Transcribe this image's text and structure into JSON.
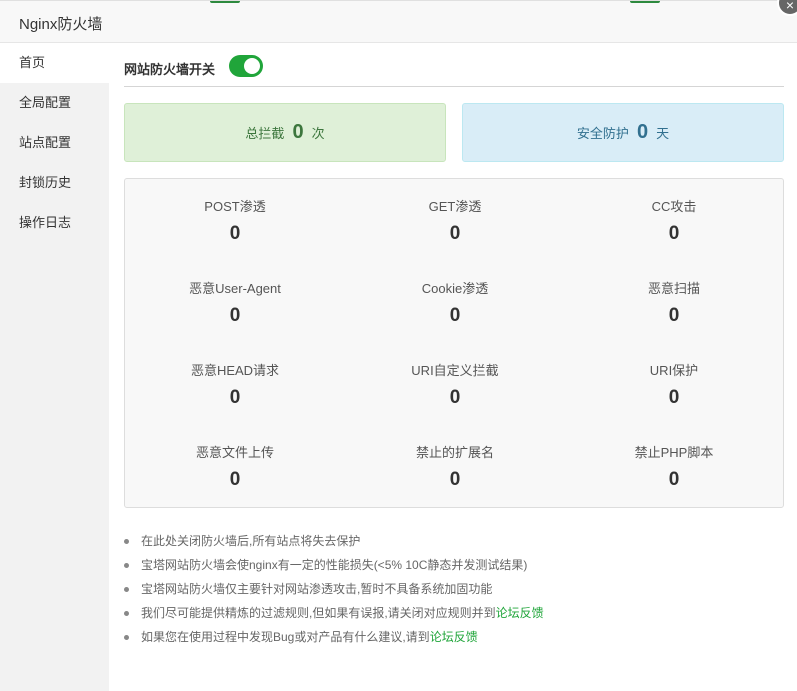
{
  "window": {
    "title": "Nginx防火墙",
    "close_glyph": "×"
  },
  "sidebar": {
    "items": [
      {
        "label": "首页",
        "active": true
      },
      {
        "label": "全局配置",
        "active": false
      },
      {
        "label": "站点配置",
        "active": false
      },
      {
        "label": "封锁历史",
        "active": false
      },
      {
        "label": "操作日志",
        "active": false
      }
    ]
  },
  "main": {
    "switch": {
      "label": "网站防火墙开关",
      "on": true,
      "accent": "#20a53a"
    },
    "stats": {
      "total": {
        "prefix": "总拦截",
        "value": "0",
        "unit": "次"
      },
      "safe": {
        "prefix": "安全防护",
        "value": "0",
        "unit": "天"
      }
    },
    "grid": [
      {
        "label": "POST渗透",
        "value": "0"
      },
      {
        "label": "GET渗透",
        "value": "0"
      },
      {
        "label": "CC攻击",
        "value": "0"
      },
      {
        "label": "恶意User-Agent",
        "value": "0"
      },
      {
        "label": "Cookie渗透",
        "value": "0"
      },
      {
        "label": "恶意扫描",
        "value": "0"
      },
      {
        "label": "恶意HEAD请求",
        "value": "0"
      },
      {
        "label": "URI自定义拦截",
        "value": "0"
      },
      {
        "label": "URI保护",
        "value": "0"
      },
      {
        "label": "恶意文件上传",
        "value": "0"
      },
      {
        "label": "禁止的扩展名",
        "value": "0"
      },
      {
        "label": "禁止PHP脚本",
        "value": "0"
      }
    ],
    "notes": [
      {
        "text": "在此处关闭防火墙后,所有站点将失去保护",
        "link": ""
      },
      {
        "text": "宝塔网站防火墙会使nginx有一定的性能损失(<5% 10C静态并发测试结果)",
        "link": ""
      },
      {
        "text": "宝塔网站防火墙仅主要针对网站渗透攻击,暂时不具备系统加固功能",
        "link": ""
      },
      {
        "text": "我们尽可能提供精炼的过滤规则,但如果有误报,请关闭对应规则并到",
        "link": "论坛反馈"
      },
      {
        "text": "如果您在使用过程中发现Bug或对产品有什么建议,请到",
        "link": "论坛反馈"
      }
    ]
  }
}
